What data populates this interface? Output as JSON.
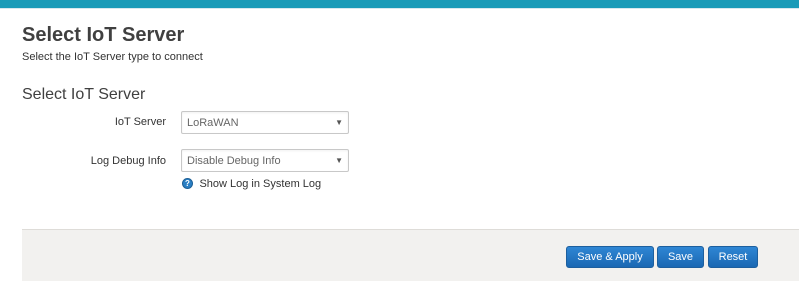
{
  "header": {
    "title": "Select IoT Server",
    "description": "Select the IoT Server type to connect"
  },
  "section": {
    "title": "Select IoT Server"
  },
  "fields": {
    "iot_server": {
      "label": "IoT Server",
      "value": "LoRaWAN"
    },
    "log_debug": {
      "label": "Log Debug Info",
      "value": "Disable Debug Info",
      "help_text": "Show Log in System Log"
    }
  },
  "footer": {
    "save_apply_label": "Save & Apply",
    "save_label": "Save",
    "reset_label": "Reset"
  },
  "icons": {
    "dropdown_arrow": "▼",
    "help_glyph": "?"
  },
  "colors": {
    "accent_bar": "#1a9bb8",
    "button": "#2275c2",
    "footer_bg": "#f2f1ef"
  }
}
